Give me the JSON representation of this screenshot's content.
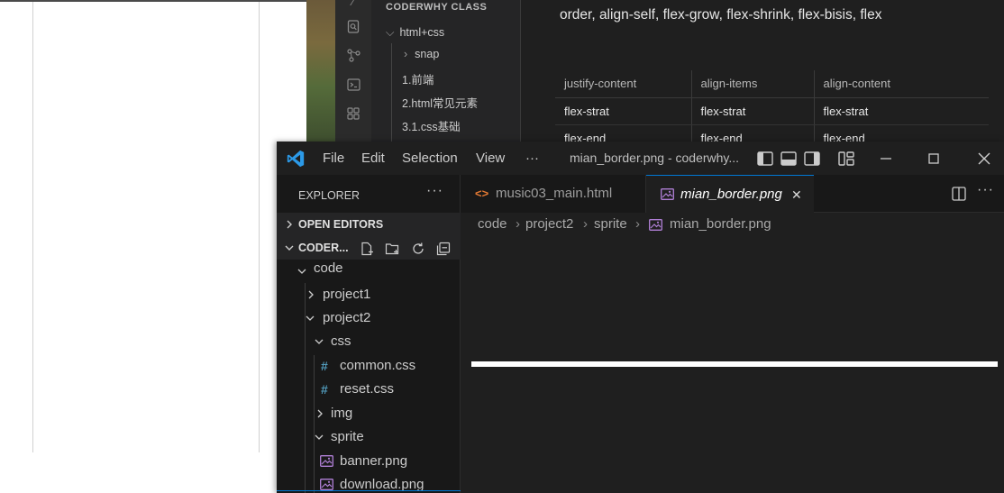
{
  "background_notes": {
    "sidebar_section": "CODERWHY CLASS",
    "tree": [
      "html+css",
      "snap",
      "1.前端",
      "2.html常见元素",
      "3.1.css基础"
    ],
    "note_text": "order, align-self, flex-grow, flex-shrink, flex-bisis, flex",
    "table": {
      "headers": [
        "justify-content",
        "align-items",
        "align-content"
      ],
      "rows": [
        [
          "flex-strat",
          "flex-strat",
          "flex-strat"
        ],
        [
          "flex-end",
          "flex-end",
          "flex-end"
        ]
      ]
    }
  },
  "vscode": {
    "menu": [
      "File",
      "Edit",
      "Selection",
      "View",
      "···"
    ],
    "window_title": "mian_border.png - coderwhy...",
    "sidebar": {
      "explorer_label": "EXPLORER",
      "more": "···",
      "open_editors": "OPEN EDITORS",
      "workspace": "CODER...",
      "tree": [
        {
          "label": "code",
          "kind": "folder-open",
          "depth": 0
        },
        {
          "label": "project1",
          "kind": "folder-closed",
          "depth": 1
        },
        {
          "label": "project2",
          "kind": "folder-open",
          "depth": 1
        },
        {
          "label": "css",
          "kind": "folder-open",
          "depth": 2
        },
        {
          "label": "common.css",
          "kind": "css-file",
          "depth": 3
        },
        {
          "label": "reset.css",
          "kind": "css-file",
          "depth": 3
        },
        {
          "label": "img",
          "kind": "folder-closed",
          "depth": 2
        },
        {
          "label": "sprite",
          "kind": "folder-open",
          "depth": 2
        },
        {
          "label": "banner.png",
          "kind": "image-file",
          "depth": 3
        },
        {
          "label": "download.png",
          "kind": "image-file",
          "depth": 3
        }
      ]
    },
    "tabs": [
      {
        "label": "music03_main.html",
        "icon": "html-icon",
        "active": false
      },
      {
        "label": "mian_border.png",
        "icon": "image-icon",
        "active": true,
        "close": "✕"
      }
    ],
    "breadcrumb": [
      "code",
      "project2",
      "sprite",
      "mian_border.png"
    ],
    "colors": {
      "accent": "#0078d4",
      "image_icon": "#b180d7",
      "html_icon": "#e37933",
      "css_icon": "#519aba"
    }
  }
}
